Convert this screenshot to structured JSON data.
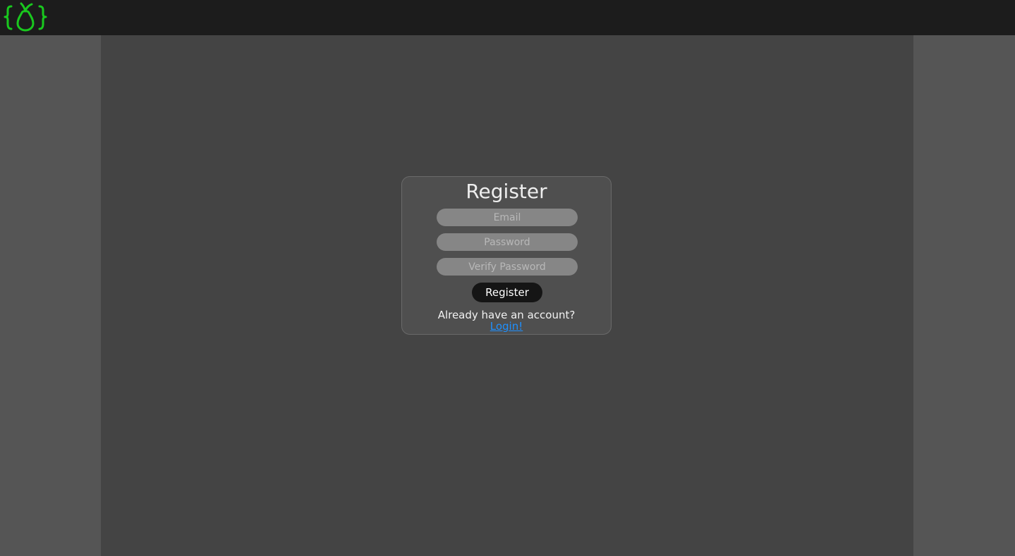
{
  "brand": {
    "logo_icon": "pear-braces-logo",
    "logo_color": "#19c81e"
  },
  "colors": {
    "topbar": "#1c1c1c",
    "side_gutter": "#555555",
    "main_bg": "#444444",
    "card_bg": "#4f4f4f",
    "input_bg": "#868686",
    "button_bg": "#151515",
    "link": "#1e90ff"
  },
  "register": {
    "title": "Register",
    "email_placeholder": "Email",
    "password_placeholder": "Password",
    "verify_placeholder": "Verify Password",
    "submit_label": "Register",
    "login_prompt": "Already have an account?",
    "login_link": "Login!"
  }
}
